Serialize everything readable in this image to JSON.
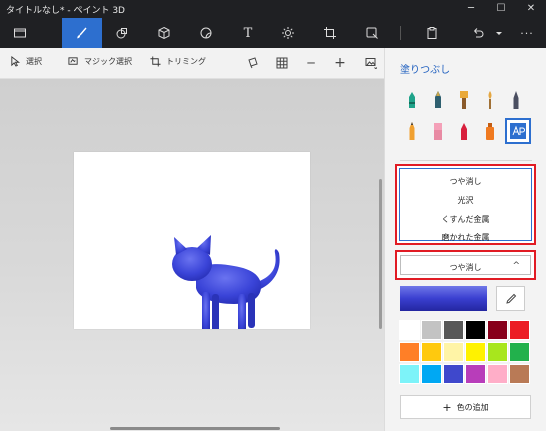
{
  "window": {
    "title": "タイトルなし* - ペイント 3D",
    "minimize_glyph": "─",
    "maximize_glyph": "☐",
    "close_glyph": "✕"
  },
  "toolbar": {
    "text_tool_glyph": "T",
    "more_glyph": "···"
  },
  "subbar": {
    "select_label": "選択",
    "magic_select_label": "マジック選択",
    "crop_label": "トリミング",
    "zoom_out_glyph": "─",
    "zoom_in_glyph": "+"
  },
  "panel": {
    "title": "塗りつぶし",
    "finish_options": [
      "つや消し",
      "光沢",
      "くすんだ金属",
      "磨かれた金属"
    ],
    "finish_selected": "つや消し",
    "chevron_glyph": "^",
    "add_color_label": "色の追加",
    "add_color_glyph": "+",
    "current_color": "#3a3fd0"
  },
  "palette": [
    "#ffffff",
    "#c3c3c3",
    "#585858",
    "#000000",
    "#88001b",
    "#ec1c24",
    "#ff7f27",
    "#ffc90e",
    "#fff4a6",
    "#fff200",
    "#a8e61d",
    "#22b14c",
    "#7df3f9",
    "#00a8f3",
    "#3f48cc",
    "#b83dba",
    "#ffaec8",
    "#b97a56"
  ],
  "colors": {
    "accent": "#2d6fcf",
    "highlight_box": "#e11b24",
    "cat_body": "#3a44d8"
  }
}
